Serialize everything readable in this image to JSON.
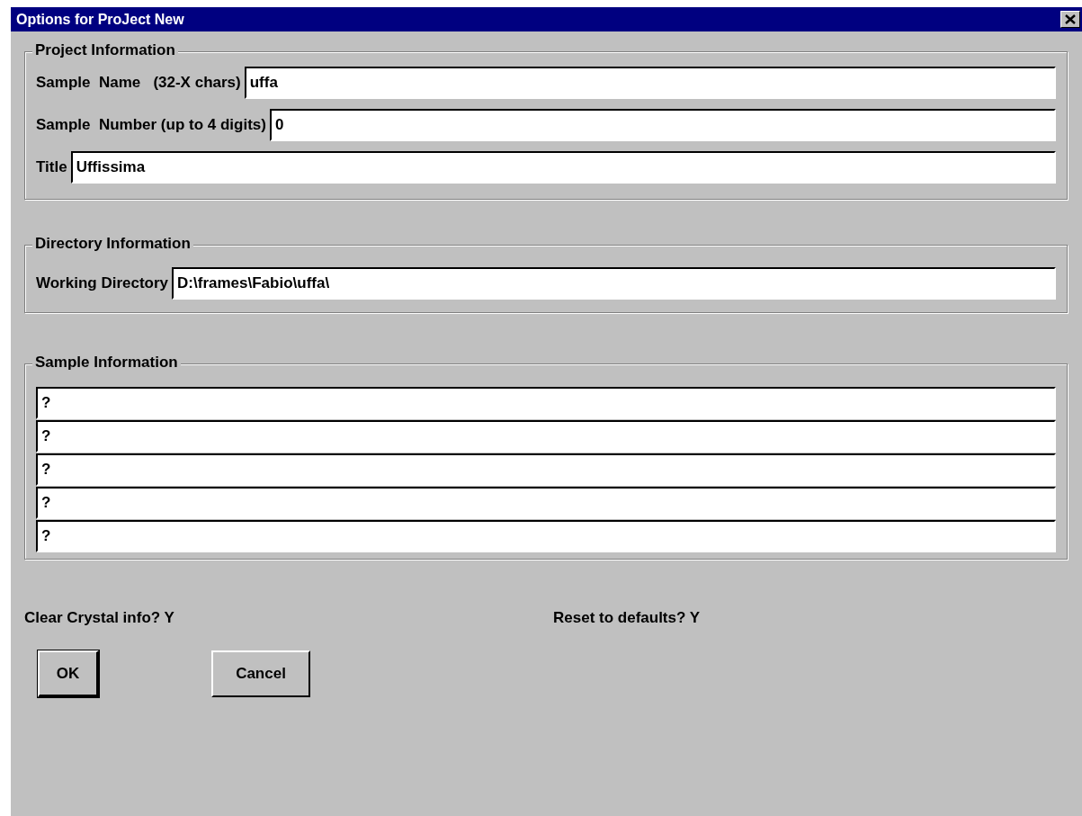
{
  "window": {
    "title": "Options for ProJect New"
  },
  "groups": [
    {
      "title": "Project Information",
      "fields": [
        {
          "label": "Sample  Name   (32-X chars)",
          "value": "uffa"
        },
        {
          "label": "Sample  Number (up to 4 digits)",
          "value": "0"
        },
        {
          "label": "Title",
          "value": "Uffissima"
        }
      ]
    },
    {
      "title": "Directory Information",
      "fields": [
        {
          "label": "Working Directory",
          "value": "D:\\frames\\Fabio\\uffa\\"
        }
      ]
    },
    {
      "title": "Sample  Information",
      "fields": [
        {
          "value": "?"
        },
        {
          "value": "?"
        },
        {
          "value": "?"
        },
        {
          "value": "?"
        },
        {
          "value": "?"
        }
      ]
    }
  ],
  "prompts": [
    "Clear Crystal info? Y",
    "Reset to defaults? Y"
  ],
  "buttons": [
    {
      "label": "OK",
      "default": true
    },
    {
      "label": "Cancel",
      "default": false
    }
  ]
}
